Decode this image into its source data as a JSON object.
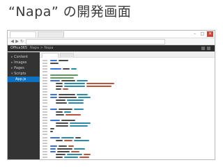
{
  "slide": {
    "title": "“Napa” の開発画面"
  },
  "window": {
    "app_name": "Office365",
    "breadcrumb": "Napa  >  Napa",
    "controls": [
      "–",
      "□",
      "×"
    ]
  },
  "sidebar": {
    "items": [
      {
        "label": "Content",
        "level": 0
      },
      {
        "label": "Images",
        "level": 0
      },
      {
        "label": "Pages",
        "level": 0
      },
      {
        "label": "Scripts",
        "level": 0
      },
      {
        "label": "App.js",
        "level": 1,
        "selected": true
      }
    ]
  },
  "colors": {
    "sidebar_bg": "#333333",
    "selected_item": "#0e70c0",
    "close_button": "#c7463a"
  },
  "icons": [
    "back-icon",
    "forward-icon",
    "refresh-icon",
    "minimize-icon",
    "maximize-icon",
    "close-icon"
  ]
}
